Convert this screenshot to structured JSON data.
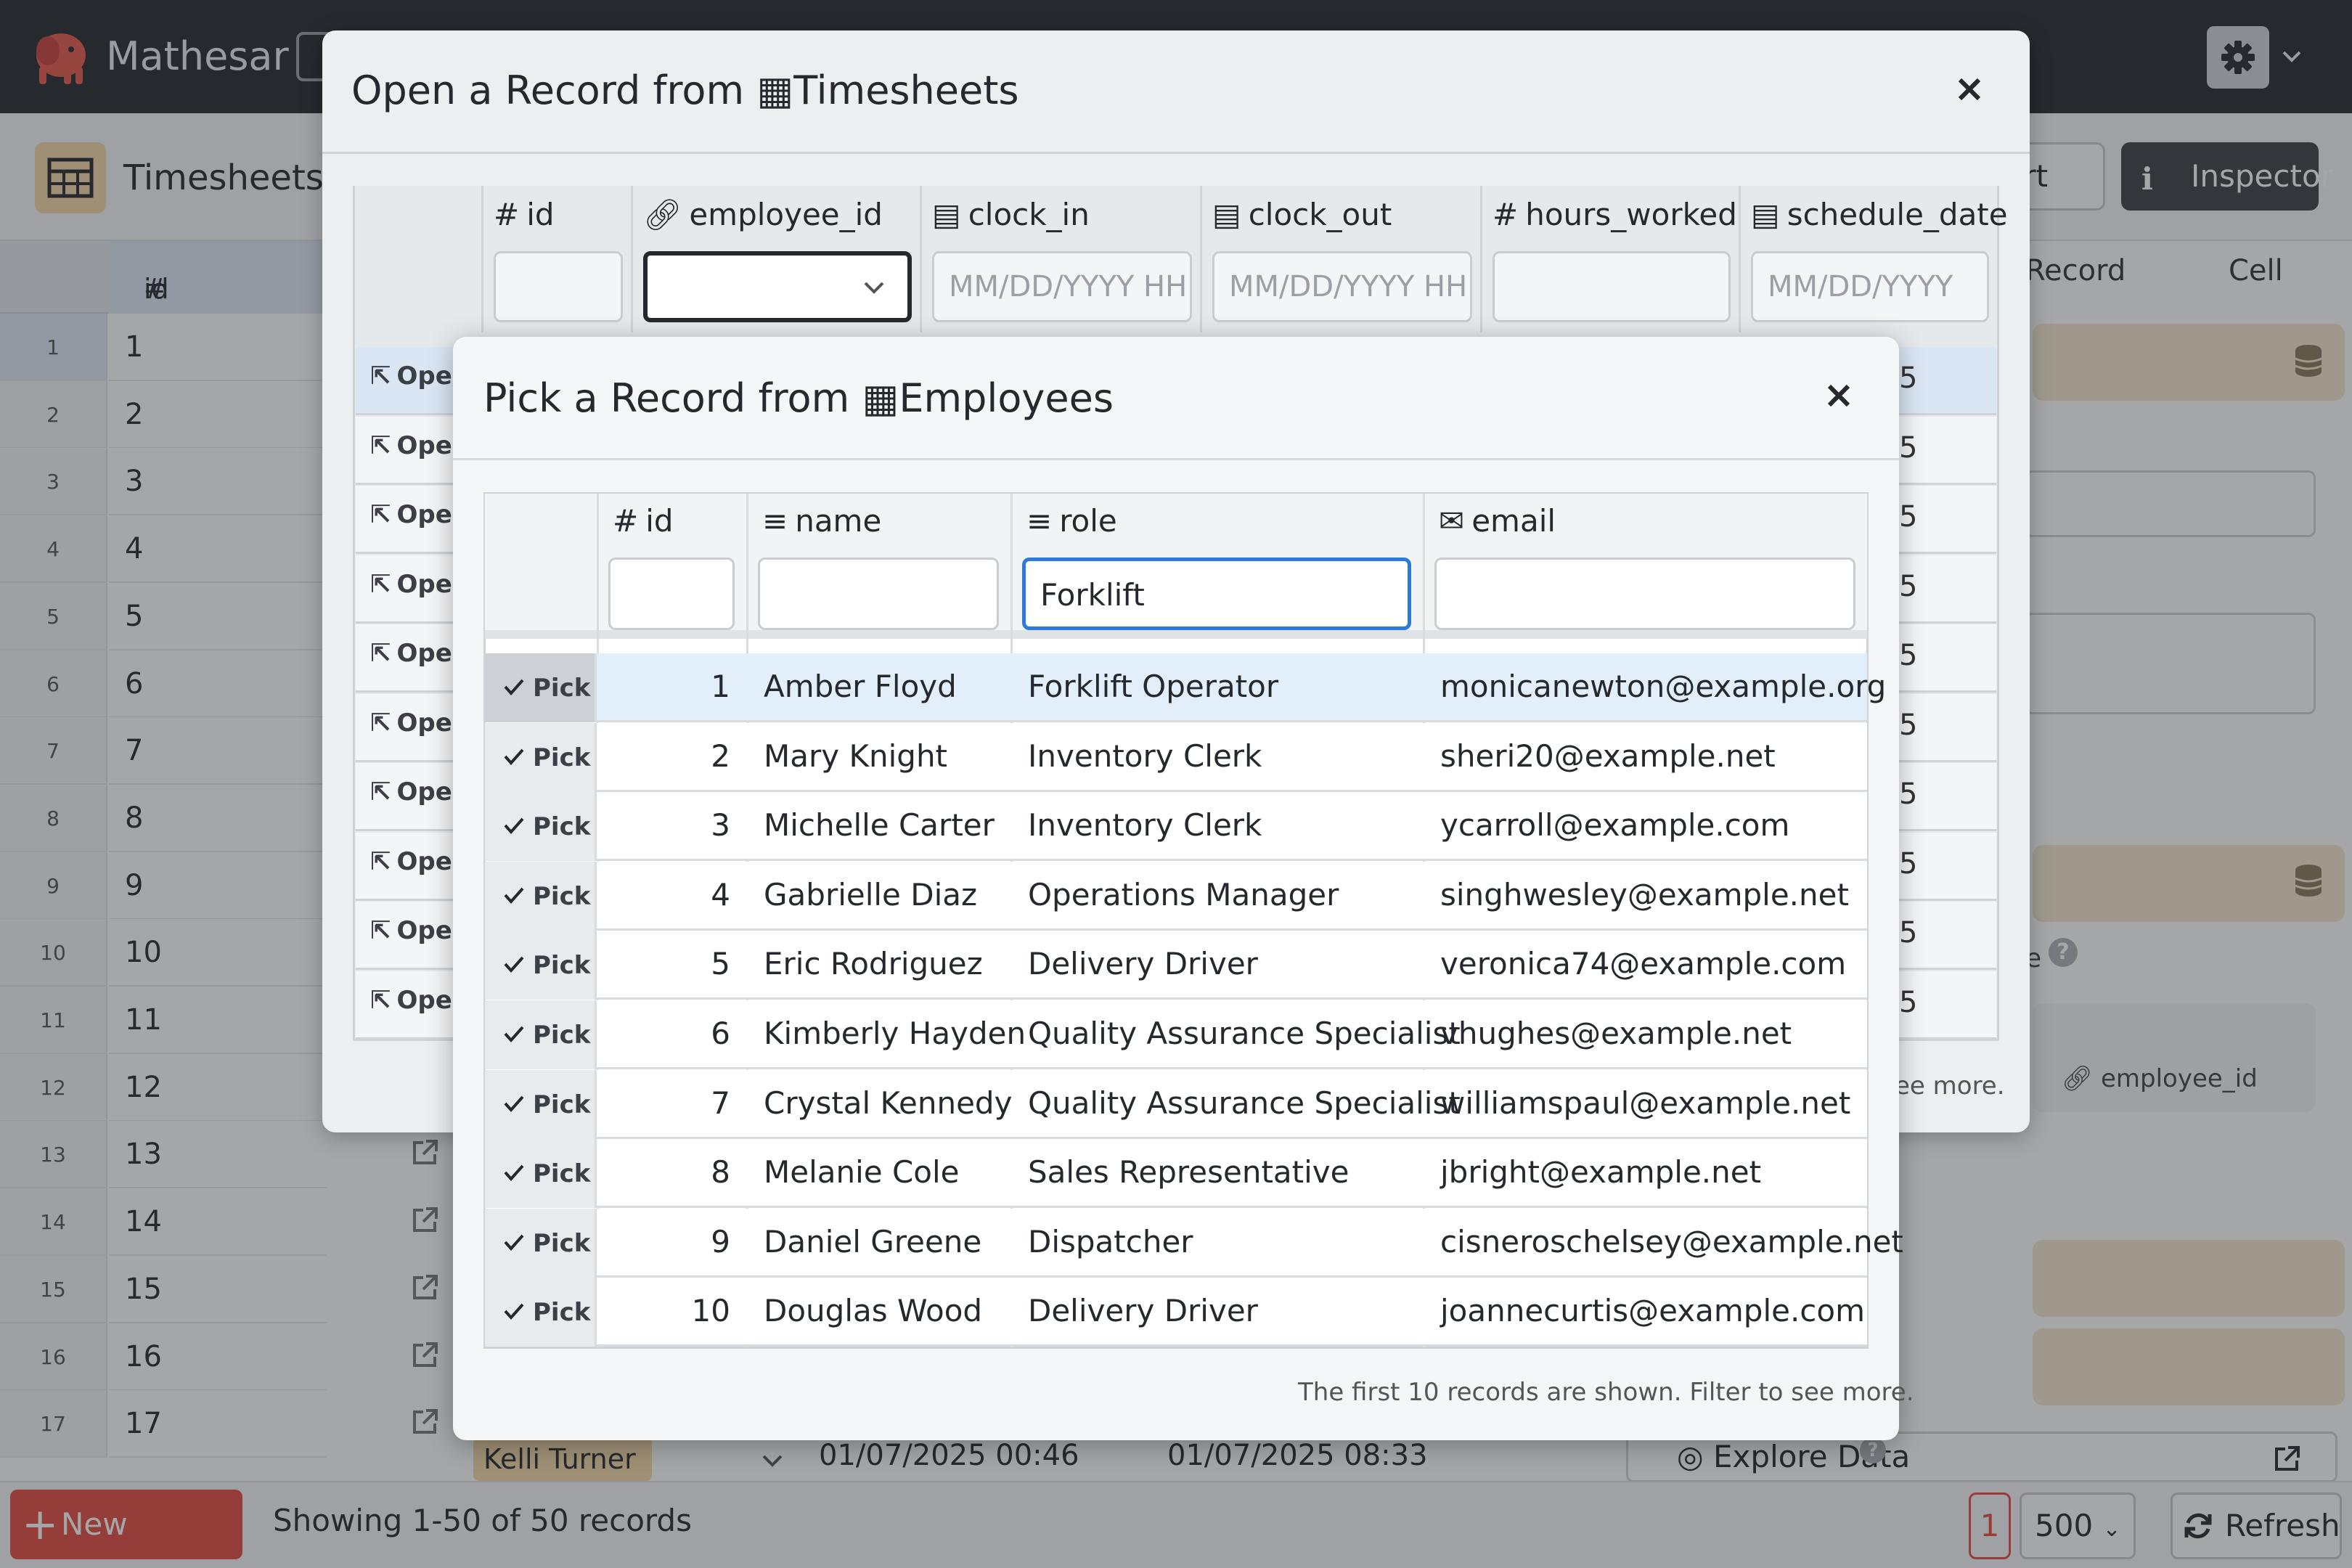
{
  "app": {
    "name": "Mathesar"
  },
  "header": {
    "table_title": "Timesheets",
    "export_label": "port",
    "inspector_label": "Inspector"
  },
  "background_grid": {
    "id_header": "id",
    "rows": [
      "1",
      "2",
      "3",
      "4",
      "5",
      "6",
      "7",
      "8",
      "9",
      "10",
      "11",
      "12",
      "13",
      "14",
      "15",
      "16",
      "17"
    ],
    "row17": {
      "employee": "Kelli Turner",
      "clock_in": "01/07/2025 00:46",
      "clock_out": "01/07/2025 08:33"
    }
  },
  "inspector": {
    "tab_record": "Record",
    "tab_cell": "Cell",
    "help_mark": "?",
    "field_label": "employee_id",
    "see_more": "ee more.",
    "explore_label": "Explore Data",
    "help_prefix": "e"
  },
  "footer": {
    "new_record": "New Record",
    "showing": "Showing 1-50 of 50 records",
    "page": "1",
    "page_size": "500",
    "refresh": "Refresh"
  },
  "open_modal": {
    "title_prefix": "Open a Record from",
    "table_name": "Timesheets",
    "columns": [
      {
        "name": "id",
        "icon": "hash-icon",
        "placeholder": ""
      },
      {
        "name": "employee_id",
        "icon": "link-icon",
        "placeholder": ""
      },
      {
        "name": "clock_in",
        "icon": "calendar-icon",
        "placeholder": "MM/DD/YYYY HH"
      },
      {
        "name": "clock_out",
        "icon": "calendar-icon",
        "placeholder": "MM/DD/YYYY HH"
      },
      {
        "name": "hours_worked",
        "icon": "hash-icon",
        "placeholder": ""
      },
      {
        "name": "schedule_date",
        "icon": "calendar-icon",
        "placeholder": "MM/DD/YYYY"
      }
    ],
    "open_label": "Ope",
    "row_tail": "5",
    "see_more": "ee more."
  },
  "pick_modal": {
    "title_prefix": "Pick a Record from",
    "table_name": "Employees",
    "columns": [
      {
        "name": "id",
        "icon": "hash-icon",
        "filter": ""
      },
      {
        "name": "name",
        "icon": "text-icon",
        "filter": ""
      },
      {
        "name": "role",
        "icon": "text-icon",
        "filter": "Forklift"
      },
      {
        "name": "email",
        "icon": "envelope-icon",
        "filter": ""
      }
    ],
    "pick_label": "Pick",
    "rows": [
      {
        "id": "1",
        "name": "Amber Floyd",
        "role": "Forklift Operator",
        "email": "monicanewton@example.org"
      },
      {
        "id": "2",
        "name": "Mary Knight",
        "role": "Inventory Clerk",
        "email": "sheri20@example.net"
      },
      {
        "id": "3",
        "name": "Michelle Carter",
        "role": "Inventory Clerk",
        "email": "ycarroll@example.com"
      },
      {
        "id": "4",
        "name": "Gabrielle Diaz",
        "role": "Operations Manager",
        "email": "singhwesley@example.net"
      },
      {
        "id": "5",
        "name": "Eric Rodriguez",
        "role": "Delivery Driver",
        "email": "veronica74@example.com"
      },
      {
        "id": "6",
        "name": "Kimberly Hayden",
        "role": "Quality Assurance Specialist",
        "email": "vhughes@example.net"
      },
      {
        "id": "7",
        "name": "Crystal Kennedy",
        "role": "Quality Assurance Specialist",
        "email": "williamspaul@example.net"
      },
      {
        "id": "8",
        "name": "Melanie Cole",
        "role": "Sales Representative",
        "email": "jbright@example.net"
      },
      {
        "id": "9",
        "name": "Daniel Greene",
        "role": "Dispatcher",
        "email": "cisneroschelsey@example.net"
      },
      {
        "id": "10",
        "name": "Douglas Wood",
        "role": "Delivery Driver",
        "email": "joannecurtis@example.com"
      }
    ],
    "footer_note": "The first 10 records are shown. Filter to see more."
  },
  "colors": {
    "accent_red": "#e44b41",
    "topbar": "#25292e",
    "table_chip": "#f4d9a8",
    "focus_blue": "#2f7ad8",
    "selected_row": "#e3eefb"
  }
}
